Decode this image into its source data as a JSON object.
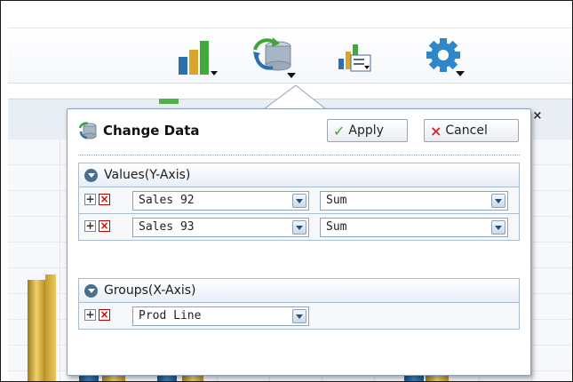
{
  "popup": {
    "title": "Change Data",
    "apply_label": "Apply",
    "cancel_label": "Cancel",
    "close_glyph": "×",
    "apply_glyph": "✓",
    "cancel_glyph": "×"
  },
  "values_section": {
    "label": "Values(Y-Axis)",
    "rows": [
      {
        "field": "Sales 92",
        "aggregate": "Sum"
      },
      {
        "field": "Sales 93",
        "aggregate": "Sum"
      }
    ]
  },
  "groups_section": {
    "label": "Groups(X-Axis)",
    "rows": [
      {
        "field": "Prod Line"
      }
    ]
  },
  "toolbar": {
    "icons": [
      "bar-chart-icon",
      "database-refresh-icon",
      "chart-list-icon",
      "gear-icon"
    ]
  },
  "colors": {
    "accent_blue": "#2c6fb0",
    "gold": "#d9b13f",
    "green": "#3fa53a",
    "cancel_red": "#d12b2b"
  }
}
